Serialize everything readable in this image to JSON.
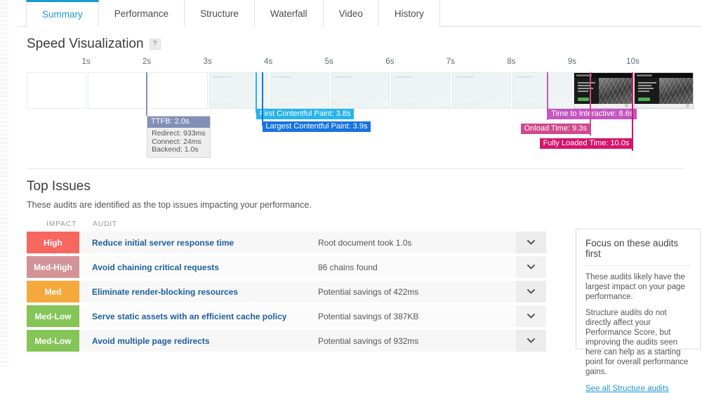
{
  "tabs": [
    {
      "label": "Summary",
      "active": true
    },
    {
      "label": "Performance",
      "active": false
    },
    {
      "label": "Structure",
      "active": false
    },
    {
      "label": "Waterfall",
      "active": false
    },
    {
      "label": "Video",
      "active": false
    },
    {
      "label": "History",
      "active": false
    }
  ],
  "speed_visualization": {
    "title": "Speed Visualization",
    "help_icon": "?",
    "help_glyph": "?",
    "ticks": [
      "1s",
      "2s",
      "3s",
      "4s",
      "5s",
      "6s",
      "7s",
      "8s",
      "9s",
      "10s"
    ],
    "markers": [
      {
        "name": "ttfb",
        "label": "TTFB: 2.0s",
        "time": 2.0,
        "color": "#8190b7",
        "details": [
          "Redirect: 933ms",
          "Connect: 24ms",
          "Backend: 1.0s"
        ]
      },
      {
        "name": "first-contentful-paint",
        "label": "First Contentful Paint: 3.8s",
        "time": 3.8,
        "color": "#28b4ec"
      },
      {
        "name": "largest-contentful-paint",
        "label": "Largest Contentful Paint: 3.9s",
        "time": 3.9,
        "color": "#1773e0"
      },
      {
        "name": "time-to-interactive",
        "label": "Time to Interactive: 8.6s",
        "time": 8.6,
        "color": "#c555c0"
      },
      {
        "name": "onload-time",
        "label": "Onload Time: 9.3s",
        "time": 9.3,
        "color": "#d14a8d"
      },
      {
        "name": "fully-loaded-time",
        "label": "Fully Loaded Time: 10.0s",
        "time": 10.0,
        "color": "#d6146b"
      }
    ],
    "frame_count": 11
  },
  "top_issues": {
    "title": "Top Issues",
    "subtitle": "These audits are identified as the top issues impacting your performance.",
    "columns": {
      "impact": "IMPACT",
      "audit": "AUDIT"
    },
    "rows": [
      {
        "impact": "High",
        "impact_color": "#f5675f",
        "audit": "Reduce initial server response time",
        "detail": "Root document took 1.0s"
      },
      {
        "impact": "Med-High",
        "impact_color": "#d39396",
        "audit": "Avoid chaining critical requests",
        "detail": "86 chains found"
      },
      {
        "impact": "Med",
        "impact_color": "#f5a93c",
        "audit": "Eliminate render-blocking resources",
        "detail": "Potential savings of 422ms"
      },
      {
        "impact": "Med-Low",
        "impact_color": "#85c457",
        "audit": "Serve static assets with an efficient cache policy",
        "detail": "Potential savings of 387KB"
      },
      {
        "impact": "Med-Low",
        "impact_color": "#85c457",
        "audit": "Avoid multiple page redirects",
        "detail": "Potential savings of 932ms"
      }
    ]
  },
  "focus_panel": {
    "title": "Focus on these audits first",
    "paragraph1": "These audits likely have the largest impact on your page performance.",
    "paragraph2": "Structure audits do not directly affect your Performance Score, but improving the audits seen here can help as a starting point for overall performance gains.",
    "link": "See all Structure audits"
  }
}
